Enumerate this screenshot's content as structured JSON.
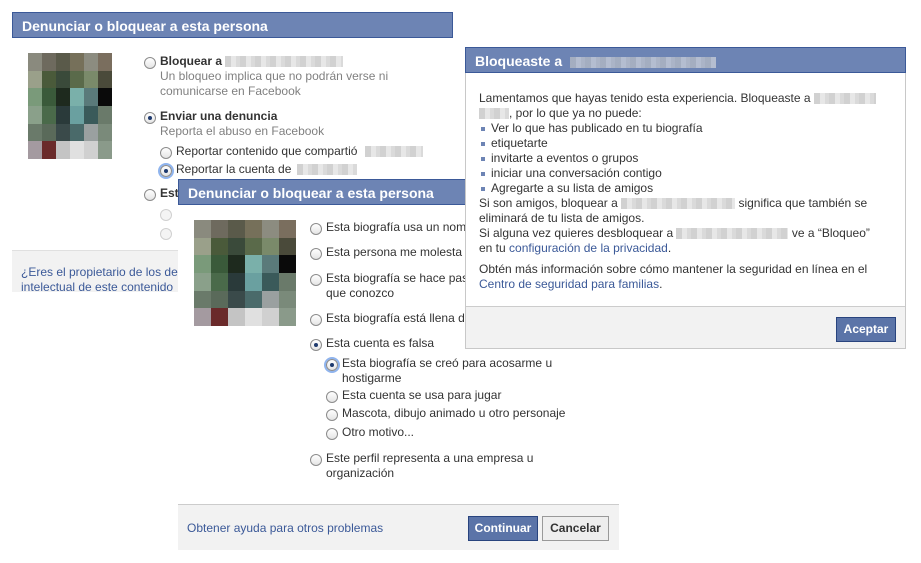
{
  "dialog_back": {
    "title": "Denunciar o bloquear a esta persona",
    "option_block_label": "Bloquear a",
    "option_block_desc_1": "Un bloqueo implica que no podrán verse ni",
    "option_block_desc_2": "comunicarse en Facebook",
    "option_report_label": "Enviar una denuncia",
    "option_report_desc": "Reporta el abuso en Facebook",
    "sub_content": "Reportar contenido que compartió",
    "sub_account": "Reportar la cuenta de",
    "option_third_label": "Est",
    "ip_link_1": "¿Eres el propietario de los de",
    "ip_link_2": "intelectual de este contenido"
  },
  "dialog_middle": {
    "title": "Denunciar o bloquear a esta persona",
    "options": [
      "Esta biografía usa un nom",
      "Esta persona me molesta",
      "Esta biografía se hace pas",
      "que conozco",
      "Esta biografía está llena d",
      "Esta cuenta es falsa"
    ],
    "sub_options": [
      "Esta biografía se creó para acosarme u",
      "hostigarme",
      "Esta cuenta se usa para jugar",
      "Mascota, dibujo animado u otro personaje",
      "Otro motivo..."
    ],
    "business_option_1": "Este perfil representa a una empresa u",
    "business_option_2": "organización",
    "help_link": "Obtener ayuda para otros problemas",
    "continue_label": "Continuar",
    "cancel_label": "Cancelar"
  },
  "dialog_front": {
    "title": "Bloqueaste a",
    "intro_1": "Lamentamos que hayas tenido esta experiencia. Bloqueaste a",
    "intro_2": ", por lo que ya no puede:",
    "bullets": [
      "Ver lo que has publicado en tu biografía",
      "etiquetarte",
      "invitarte a eventos o grupos",
      "iniciar una conversación contigo",
      "Agregarte a su lista de amigos"
    ],
    "friends_1": "Si son amigos, bloquear a",
    "friends_2": "significa que también se",
    "friends_3": "eliminará de tu lista de amigos.",
    "unblock_1": "Si alguna vez quieres desbloquear a",
    "unblock_2": "ve a “Bloqueo”",
    "unblock_3": "en tu",
    "privacy_link": "configuración de la privacidad",
    "unblock_end": ".",
    "safety_1": "Obtén más información sobre cómo mantener la seguridad en línea en el",
    "safety_link": "Centro de seguridad para familias",
    "safety_end": ".",
    "accept_label": "Aceptar"
  },
  "colors": {
    "header_bg": "#6d84b4",
    "link": "#3b5998",
    "button_primary": "#5b74a8"
  },
  "avatar_pixels": [
    "#8a8a7e",
    "#6e6a5e",
    "#5a5a4a",
    "#76705a",
    "#8c8c80",
    "#7a6e5e",
    "#9aa08a",
    "#4a5a3a",
    "#3a4a3a",
    "#5a6a4a",
    "#7a8a6a",
    "#4a4a3a",
    "#7a9a7a",
    "#3a5a3a",
    "#1e2a1e",
    "#7ab0aa",
    "#5a7a7a",
    "#0a0a0a",
    "#8aa08a",
    "#4a6a4a",
    "#2a3a3a",
    "#6aa0a0",
    "#3a5a5a",
    "#6a7a6a",
    "#6a7a6a",
    "#5a6a5a",
    "#3a4a4a",
    "#4a6a6a",
    "#9aa0a0",
    "#7a8a7a",
    "#a49aa0",
    "#6a2a2a",
    "#c4c4c4",
    "#e0e0e0",
    "#d0d0d0",
    "#8a9a8a"
  ]
}
